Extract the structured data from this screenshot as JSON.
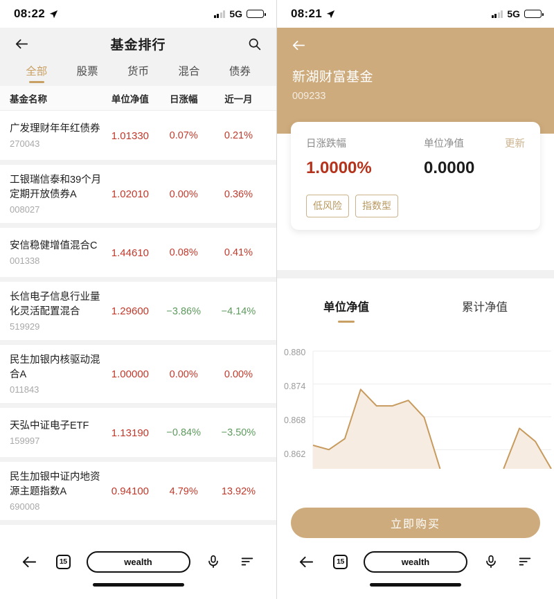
{
  "left": {
    "status": {
      "time": "08:22",
      "network": "5G",
      "battery_pct": 55,
      "location_icon": "location-arrow-icon"
    },
    "header": {
      "title": "基金排行",
      "back_icon": "back-arrow-icon",
      "search_icon": "search-icon"
    },
    "tabs": [
      {
        "label": "全部",
        "active": true
      },
      {
        "label": "股票",
        "active": false
      },
      {
        "label": "货币",
        "active": false
      },
      {
        "label": "混合",
        "active": false
      },
      {
        "label": "债券",
        "active": false
      }
    ],
    "columns": [
      "基金名称",
      "单位净值",
      "日涨幅",
      "近一月"
    ],
    "funds": [
      {
        "name": "广发理财年年红债券",
        "code": "270043",
        "nav": "1.01330",
        "day": "0.07%",
        "month": "0.21%",
        "day_dir": "up",
        "month_dir": "up"
      },
      {
        "name": "工银瑞信泰和39个月定期开放债券A",
        "code": "008027",
        "nav": "1.02010",
        "day": "0.00%",
        "month": "0.36%",
        "day_dir": "up",
        "month_dir": "up"
      },
      {
        "name": "安信稳健增值混合C",
        "code": "001338",
        "nav": "1.44610",
        "day": "0.08%",
        "month": "0.41%",
        "day_dir": "up",
        "month_dir": "up"
      },
      {
        "name": "长信电子信息行业量化灵活配置混合",
        "code": "519929",
        "nav": "1.29600",
        "day": "−3.86%",
        "month": "−4.14%",
        "day_dir": "down",
        "month_dir": "down"
      },
      {
        "name": "民生加银内核驱动混合A",
        "code": "011843",
        "nav": "1.00000",
        "day": "0.00%",
        "month": "0.00%",
        "day_dir": "up",
        "month_dir": "up"
      },
      {
        "name": "天弘中证电子ETF",
        "code": "159997",
        "nav": "1.13190",
        "day": "−0.84%",
        "month": "−3.50%",
        "day_dir": "down",
        "month_dir": "down"
      },
      {
        "name": "民生加银中证内地资源主题指数A",
        "code": "690008",
        "nav": "0.94100",
        "day": "4.79%",
        "month": "13.92%",
        "day_dir": "up",
        "month_dir": "up"
      }
    ],
    "bottombar": {
      "back_icon": "back-arrow-icon",
      "tab_count": "15",
      "url_label": "wealth",
      "mic_icon": "microphone-icon",
      "menu_icon": "menu-icon"
    }
  },
  "right": {
    "status": {
      "time": "08:21",
      "network": "5G",
      "battery_pct": 55,
      "location_icon": "location-arrow-icon"
    },
    "header": {
      "back_icon": "back-arrow-icon",
      "fund_name": "新湖财富基金",
      "fund_code": "009233"
    },
    "card": {
      "change_label": "日涨跌幅",
      "change_value": "1.0000%",
      "nav_label": "单位净值",
      "nav_value": "0.0000",
      "update_label": "更新",
      "tags": [
        "低风险",
        "指数型"
      ]
    },
    "chart_tabs": [
      {
        "label": "单位净值",
        "active": true
      },
      {
        "label": "累计净值",
        "active": false
      }
    ],
    "buy_button": "立即购买",
    "bottombar": {
      "back_icon": "back-arrow-icon",
      "tab_count": "15",
      "url_label": "wealth",
      "mic_icon": "microphone-icon",
      "menu_icon": "menu-icon"
    }
  },
  "chart_data": {
    "type": "area",
    "title": "单位净值",
    "xlabel": "",
    "ylabel": "",
    "ylim": [
      0.8585,
      0.88
    ],
    "yticks": [
      0.862,
      0.868,
      0.874,
      0.88
    ],
    "ytick_labels": [
      "0.862",
      "0.868",
      "0.874",
      "0.880"
    ],
    "grid": true,
    "legend": "none",
    "line_color": "#c79a5d",
    "fill_color": "#f6ece1",
    "series": [
      {
        "name": "单位净值",
        "x": [
          0,
          1,
          2,
          3,
          4,
          5,
          6,
          7,
          8,
          9
        ],
        "values": [
          0.8628,
          0.862,
          0.864,
          0.873,
          0.87,
          0.87,
          0.871,
          0.8679,
          0.8585,
          null
        ]
      },
      {
        "name": "单位净值 (续)",
        "x": [
          12,
          13,
          14,
          15
        ],
        "values": [
          0.8585,
          0.8659,
          0.8635,
          0.8585
        ]
      }
    ]
  }
}
